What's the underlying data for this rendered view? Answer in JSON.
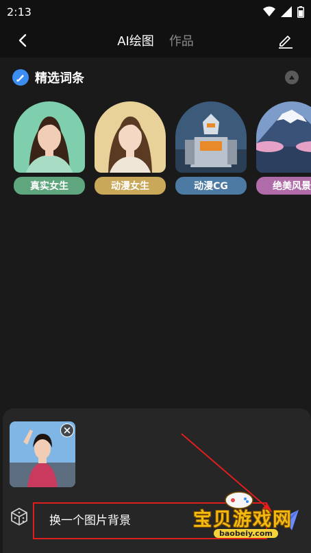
{
  "status_bar": {
    "time": "2:13"
  },
  "header": {
    "tabs": [
      {
        "label": "AI绘图",
        "active": true
      },
      {
        "label": "作品",
        "active": false
      }
    ]
  },
  "section": {
    "title": "精选词条"
  },
  "cards": [
    {
      "label": "真实女生",
      "label_color": "#5fa67e"
    },
    {
      "label": "动漫女生",
      "label_color": "#c9a85a"
    },
    {
      "label": "动漫CG",
      "label_color": "#4d7aa3"
    },
    {
      "label": "绝美风景",
      "label_color": "#b06ca8"
    }
  ],
  "prompt": {
    "value": "换一个图片背景"
  },
  "watermark": {
    "text": "宝贝游戏网",
    "url": "baobeiy.com"
  },
  "colors": {
    "accent_blue": "#3b8ef0",
    "send_arrow": "#6a8cff",
    "annotation_red": "#e01e1e"
  }
}
